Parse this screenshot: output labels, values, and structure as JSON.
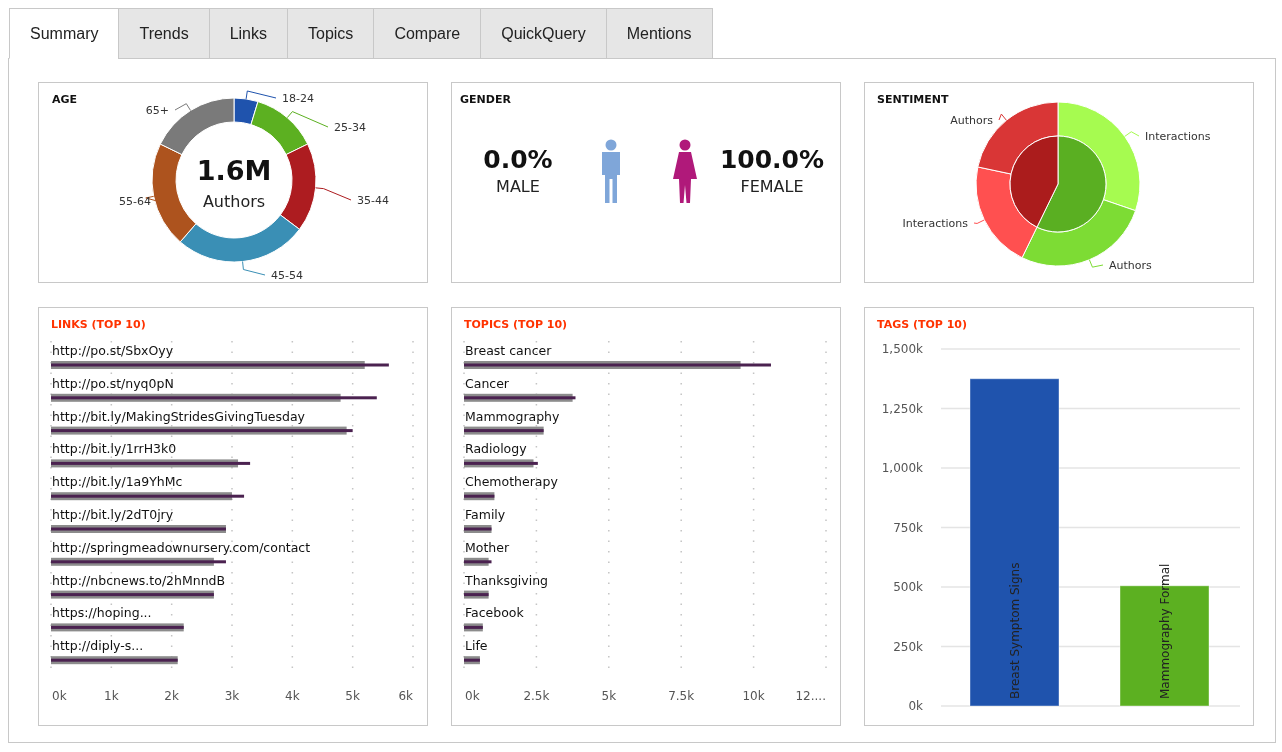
{
  "tabs": [
    {
      "label": "Summary",
      "selected": true
    },
    {
      "label": "Trends",
      "selected": false
    },
    {
      "label": "Links",
      "selected": false
    },
    {
      "label": "Topics",
      "selected": false
    },
    {
      "label": "Compare",
      "selected": false
    },
    {
      "label": "QuickQuery",
      "selected": false
    },
    {
      "label": "Mentions",
      "selected": false
    }
  ],
  "age": {
    "title": "AGE",
    "total": "1.6M",
    "total_label": "Authors",
    "segments": [
      {
        "label": "18-24",
        "color": "#1f53ad"
      },
      {
        "label": "25-34",
        "color": "#5cb021"
      },
      {
        "label": "35-44",
        "color": "#ad1c20"
      },
      {
        "label": "45-54",
        "color": "#3a8fb5"
      },
      {
        "label": "55-64",
        "color": "#ad531e"
      },
      {
        "label": "65+",
        "color": "#7a7a7a"
      }
    ]
  },
  "gender": {
    "title": "GENDER",
    "male": {
      "percent": "0.0%",
      "label": "MALE"
    },
    "female": {
      "percent": "100.0%",
      "label": "FEMALE"
    }
  },
  "sentiment": {
    "title": "SENTIMENT",
    "inner_segments": [
      {
        "color": "#5aaf22"
      },
      {
        "color": "#ab1c1c"
      }
    ],
    "outer_segments": [
      {
        "label": "Interactions",
        "color": "#a6fb50"
      },
      {
        "label": "Authors",
        "color": "#7ddc34"
      },
      {
        "label": "Interactions",
        "color": "#ff5050"
      },
      {
        "label": "Authors",
        "color": "#d93636"
      }
    ]
  },
  "links": {
    "chart_data": {
      "type": "bar",
      "orientation": "horizontal",
      "title": "LINKS (TOP 10)",
      "categories": [
        "http://po.st/SbxOyy",
        "http://po.st/nyq0pN",
        "http://bit.ly/MakingStridesGivingTuesday",
        "http://bit.ly/1rrH3k0",
        "http://bit.ly/1a9YhMc",
        "http://bit.ly/2dT0jry",
        "http://springmeadownursery.com/contact",
        "http://nbcnews.to/2hMnndB",
        "https://hoping...",
        "http://diply-s..."
      ],
      "series": [
        {
          "color": "#8c8c8c",
          "values": [
            5200,
            4800,
            4900,
            3100,
            3000,
            2900,
            2700,
            2700,
            2200,
            2100
          ]
        },
        {
          "color": "#4b2250",
          "values": [
            5600,
            5400,
            5000,
            3300,
            3200,
            2900,
            2900,
            2700,
            2200,
            2100
          ]
        }
      ],
      "grid": true,
      "xlim": [
        0,
        6000
      ],
      "xticks": [
        {
          "value": 0,
          "label": "0k"
        },
        {
          "value": 1000,
          "label": "1k"
        },
        {
          "value": 2000,
          "label": "2k"
        },
        {
          "value": 3000,
          "label": "3k"
        },
        {
          "value": 4000,
          "label": "4k"
        },
        {
          "value": 5000,
          "label": "5k"
        },
        {
          "value": 6000,
          "label": "6k"
        }
      ]
    }
  },
  "topics": {
    "chart_data": {
      "type": "bar",
      "orientation": "horizontal",
      "title": "TOPICS (TOP 10)",
      "categories": [
        "Breast cancer",
        "Cancer",
        "Mammography",
        "Radiology",
        "Chemotherapy",
        "Family",
        "Mother",
        "Thanksgiving",
        "Facebook",
        "Life"
      ],
      "series": [
        {
          "color": "#8c8c8c",
          "values": [
            9550,
            3750,
            2750,
            2400,
            1050,
            950,
            850,
            850,
            650,
            550
          ]
        },
        {
          "color": "#4b2250",
          "values": [
            10600,
            3850,
            2750,
            2550,
            1050,
            950,
            950,
            850,
            650,
            550
          ]
        }
      ],
      "grid": true,
      "xlim": [
        0,
        12500
      ],
      "xticks": [
        {
          "value": 0,
          "label": "0k"
        },
        {
          "value": 2500,
          "label": "2.5k"
        },
        {
          "value": 5000,
          "label": "5k"
        },
        {
          "value": 7500,
          "label": "7.5k"
        },
        {
          "value": 10000,
          "label": "10k"
        },
        {
          "value": 12500,
          "label": "12...."
        }
      ]
    }
  },
  "tags": {
    "chart_data": {
      "type": "bar",
      "orientation": "vertical",
      "title": "TAGS (TOP 10)",
      "categories": [
        "Breast Symptom Signs",
        "Mammography Formal"
      ],
      "grid": true,
      "series": [
        {
          "color": "#1f53ad",
          "values": [
            1375000,
            null
          ]
        },
        {
          "color": "#5cb021",
          "values": [
            null,
            505000
          ]
        }
      ],
      "ylim": [
        0,
        1500000
      ],
      "yticks": [
        {
          "value": 0,
          "label": "0k"
        },
        {
          "value": 250000,
          "label": "250k"
        },
        {
          "value": 500000,
          "label": "500k"
        },
        {
          "value": 750000,
          "label": "750k"
        },
        {
          "value": 1000000,
          "label": "1,000k"
        },
        {
          "value": 1250000,
          "label": "1,250k"
        },
        {
          "value": 1500000,
          "label": "1,500k"
        }
      ]
    }
  }
}
